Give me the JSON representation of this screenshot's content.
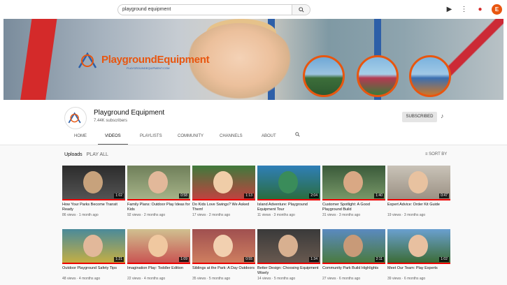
{
  "search": {
    "query": "playground equipment"
  },
  "channel": {
    "name": "Playground Equipment",
    "subscribers": "7.44K subscribers",
    "subscribe_label": "SUBSCRIBED",
    "logo_text": "PlaygroundEquipment",
    "logo_sub": "PLAYGROUNDEQUIPMENT.COM"
  },
  "tabs": [
    "Home",
    "Videos",
    "Playlists",
    "Community",
    "Channels",
    "About"
  ],
  "section": {
    "title": "Uploads",
    "play_all": "PLAY ALL",
    "sort_label": "SORT BY"
  },
  "videos": [
    {
      "title": "How Your Parks Become Transit Ready",
      "meta": "86 views · 1 month ago",
      "duration": "1:02",
      "thumb_top": "#2c2c2c",
      "thumb_bottom": "#555555",
      "accent": "#c7a27c"
    },
    {
      "title": "Family Plans: Outdoor Play Ideas for Kids",
      "meta": "92 views · 2 months ago",
      "duration": "0:58",
      "thumb_top": "#6f7f5a",
      "thumb_bottom": "#a8b58a",
      "accent": "#e2b89a"
    },
    {
      "title": "Do Kids Love Swings? We Asked Them!",
      "meta": "17 views · 2 months ago",
      "duration": "1:13",
      "thumb_top": "#3f7a3c",
      "thumb_bottom": "#c54040",
      "accent": "#f0cda8"
    },
    {
      "title": "Island Adventure: Playground Equipment Tour",
      "meta": "11 views · 3 months ago",
      "duration": "2:04",
      "thumb_top": "#2f7fb8",
      "thumb_bottom": "#2a6c3a",
      "accent": "#3a8c5a"
    },
    {
      "title": "Customer Spotlight: A Good Playground Build",
      "meta": "31 views · 3 months ago",
      "duration": "1:40",
      "thumb_top": "#3a5a3a",
      "thumb_bottom": "#7a9a6a",
      "accent": "#d9a884"
    },
    {
      "title": "Expert Advice: Order Kit Guide",
      "meta": "19 views · 3 months ago",
      "duration": "0:47",
      "thumb_top": "#c9c3b8",
      "thumb_bottom": "#9a8f82",
      "accent": "#e8c2a0"
    },
    {
      "title": "Outdoor Playground Safety Tips",
      "meta": "48 views · 4 months ago",
      "duration": "1:21",
      "thumb_top": "#4a8a9a",
      "thumb_bottom": "#c9b040",
      "accent": "#e2b89a"
    },
    {
      "title": "Imagination Play: Toddler Edition",
      "meta": "22 views · 4 months ago",
      "duration": "1:09",
      "thumb_top": "#d0c090",
      "thumb_bottom": "#c95050",
      "accent": "#f0c8a0"
    },
    {
      "title": "Siblings at the Park: A Day Outdoors",
      "meta": "35 views · 5 months ago",
      "duration": "0:55",
      "thumb_top": "#a05050",
      "thumb_bottom": "#d08060",
      "accent": "#f2d0b0"
    },
    {
      "title": "Better Design: Choosing Equipment Wisely",
      "meta": "14 views · 5 months ago",
      "duration": "1:34",
      "thumb_top": "#3a3a3a",
      "thumb_bottom": "#6a5a50",
      "accent": "#d8b090"
    },
    {
      "title": "Community Park Build Highlights",
      "meta": "27 views · 6 months ago",
      "duration": "2:11",
      "thumb_top": "#5a8ac0",
      "thumb_bottom": "#4a7a3a",
      "accent": "#c89a78"
    },
    {
      "title": "Meet Our Team: Play Experts",
      "meta": "39 views · 6 months ago",
      "duration": "1:02",
      "thumb_top": "#6aa0d0",
      "thumb_bottom": "#3a6a30",
      "accent": "#e8c0a0"
    }
  ]
}
